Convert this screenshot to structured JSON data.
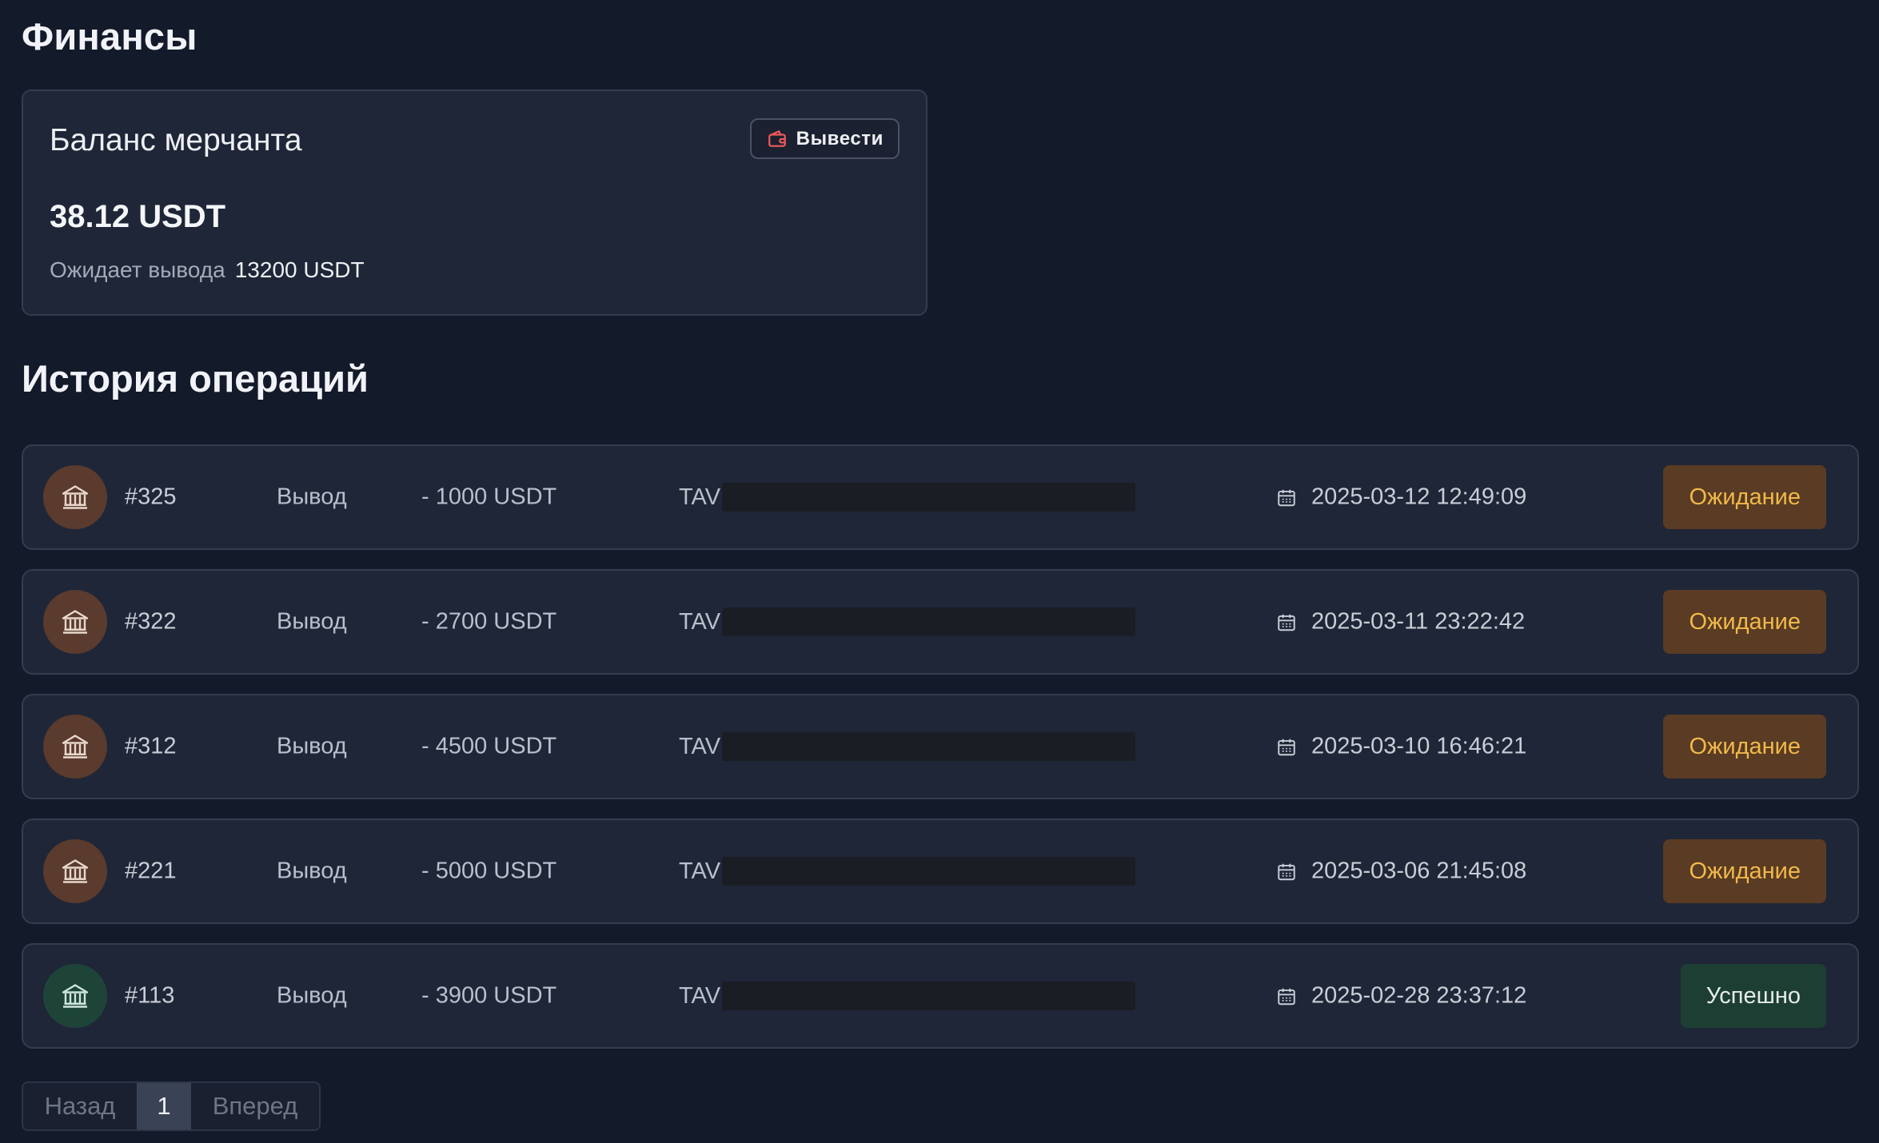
{
  "header": {
    "title": "Финансы"
  },
  "balance": {
    "title": "Баланс мерчанта",
    "withdraw_label": "Вывести",
    "amount": "38.12 USDT",
    "pending_label": "Ожидает вывода",
    "pending_value": "13200 USDT"
  },
  "history": {
    "title": "История операций",
    "rows": [
      {
        "id": "#325",
        "type": "Вывод",
        "amount": "- 1000 USDT",
        "address_prefix": "TAV",
        "date": "2025-03-12 12:49:09",
        "status": "Ожидание",
        "state": "pending"
      },
      {
        "id": "#322",
        "type": "Вывод",
        "amount": "- 2700 USDT",
        "address_prefix": "TAV",
        "date": "2025-03-11 23:22:42",
        "status": "Ожидание",
        "state": "pending"
      },
      {
        "id": "#312",
        "type": "Вывод",
        "amount": "- 4500 USDT",
        "address_prefix": "TAV",
        "date": "2025-03-10 16:46:21",
        "status": "Ожидание",
        "state": "pending"
      },
      {
        "id": "#221",
        "type": "Вывод",
        "amount": "- 5000 USDT",
        "address_prefix": "TAV",
        "date": "2025-03-06 21:45:08",
        "status": "Ожидание",
        "state": "pending"
      },
      {
        "id": "#113",
        "type": "Вывод",
        "amount": "- 3900 USDT",
        "address_prefix": "TAV",
        "date": "2025-02-28 23:37:12",
        "status": "Успешно",
        "state": "success"
      }
    ]
  },
  "pagination": {
    "prev": "Назад",
    "current": "1",
    "next": "Вперед"
  },
  "colors": {
    "background": "#131a2a",
    "card": "#1f2637",
    "pending_text": "#f0b94a",
    "pending_bg": "#5a3b23",
    "success_bg": "#1d3f33",
    "wallet_icon": "#f05a5a"
  },
  "icons": {
    "withdraw": "wallet-icon",
    "operation": "bank-icon",
    "date": "calendar-icon"
  }
}
